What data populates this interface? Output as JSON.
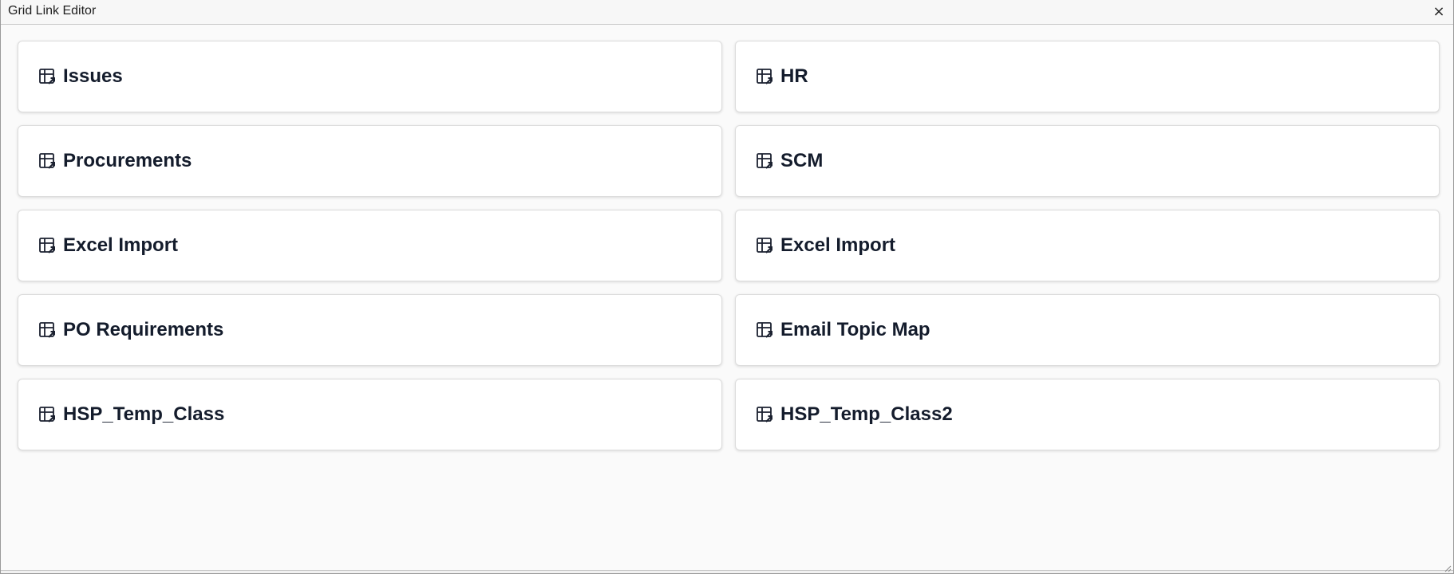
{
  "window": {
    "title": "Grid Link Editor",
    "close_label": "×"
  },
  "cards": [
    {
      "label": "Issues",
      "icon": "table-link-icon"
    },
    {
      "label": "HR",
      "icon": "table-link-icon"
    },
    {
      "label": "Procurements",
      "icon": "table-link-icon"
    },
    {
      "label": "SCM",
      "icon": "table-link-icon"
    },
    {
      "label": "Excel Import",
      "icon": "table-link-icon"
    },
    {
      "label": "Excel Import",
      "icon": "table-link-icon"
    },
    {
      "label": "PO Requirements",
      "icon": "table-link-icon"
    },
    {
      "label": "Email Topic Map",
      "icon": "table-link-icon"
    },
    {
      "label": "HSP_Temp_Class",
      "icon": "table-link-icon"
    },
    {
      "label": "HSP_Temp_Class2",
      "icon": "table-link-icon"
    }
  ],
  "colors": {
    "card_text": "#141c2c",
    "card_border": "#dcdcdc",
    "background": "#fafafa"
  }
}
